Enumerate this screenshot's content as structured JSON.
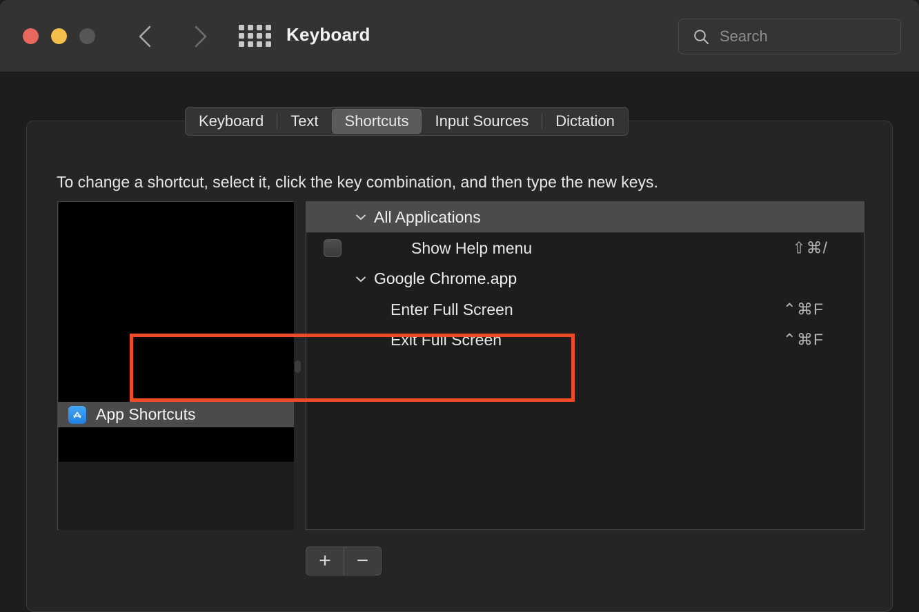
{
  "window": {
    "title": "Keyboard",
    "traffic_lights": [
      "close-button",
      "minimize-button",
      "zoom-button"
    ],
    "back_label": "Back",
    "forward_label": "Forward",
    "grid_label": "Show All"
  },
  "search": {
    "placeholder": "Search",
    "value": ""
  },
  "tabs": [
    {
      "label": "Keyboard",
      "active": false
    },
    {
      "label": "Text",
      "active": false
    },
    {
      "label": "Shortcuts",
      "active": true
    },
    {
      "label": "Input Sources",
      "active": false
    },
    {
      "label": "Dictation",
      "active": false
    }
  ],
  "main": {
    "instructions": "To change a shortcut, select it, click the key combination, and then type the new keys."
  },
  "categories": {
    "selected": "App Shortcuts",
    "selected_icon": "app-store-icon"
  },
  "shortcut_groups": [
    {
      "label": "All Applications",
      "disclosure": "chevron-down-icon",
      "header_highlighted": true,
      "rows": [
        {
          "label": "Show Help menu",
          "keys": "⇧⌘/",
          "checkbox": true,
          "checked": false,
          "highlighted": false
        }
      ]
    },
    {
      "label": "Google Chrome.app",
      "disclosure": "chevron-down-icon",
      "header_highlighted": false,
      "rows": [
        {
          "label": "Enter Full Screen",
          "keys": "⌃⌘F",
          "checkbox": false,
          "checked": false,
          "highlighted": true
        },
        {
          "label": "Exit Full Screen",
          "keys": "⌃⌘F",
          "checkbox": false,
          "checked": false,
          "highlighted": true
        }
      ]
    }
  ],
  "annotation": {
    "color": "#f04a28",
    "targets": [
      "Enter Full Screen",
      "Exit Full Screen"
    ]
  },
  "buttons": {
    "add_label": "+",
    "remove_label": "−"
  }
}
